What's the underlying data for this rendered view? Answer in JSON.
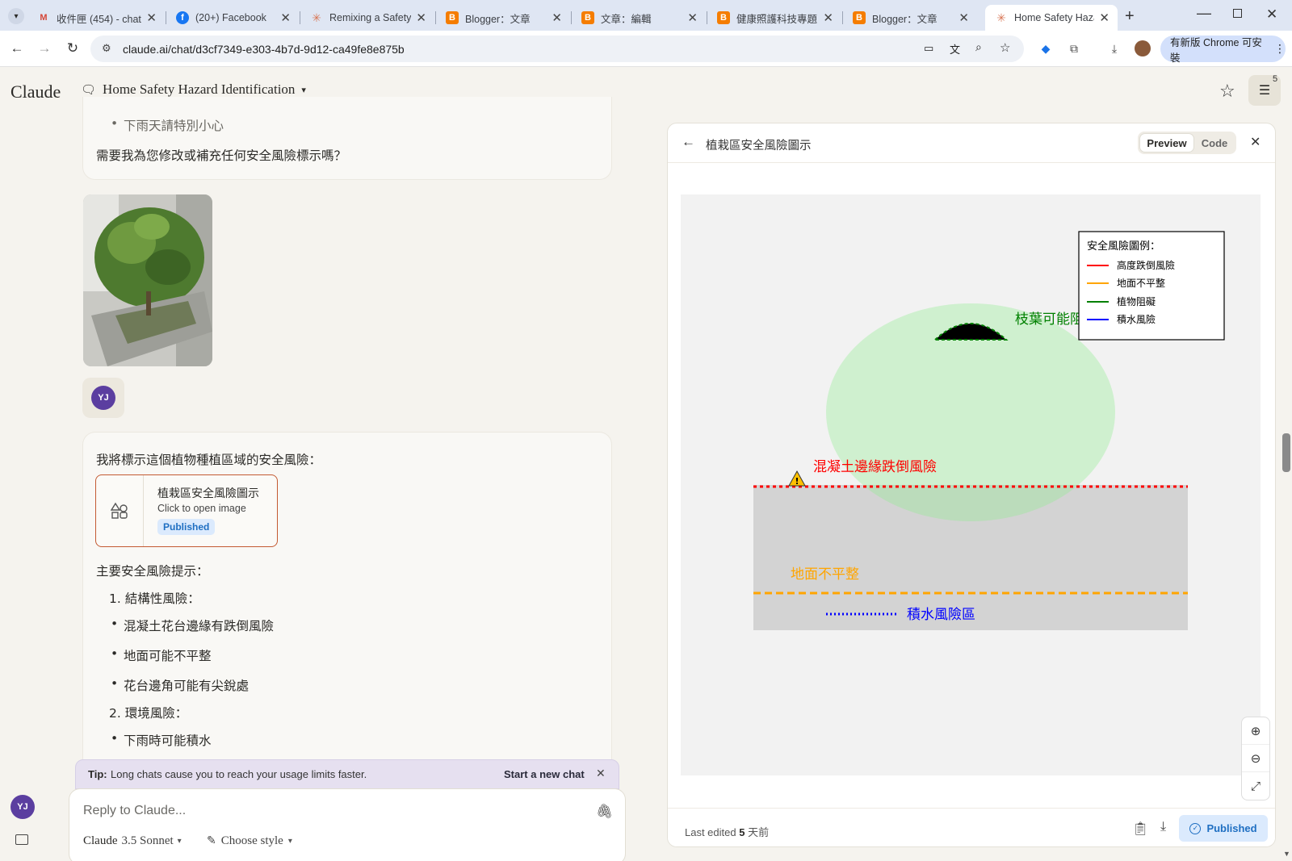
{
  "browser": {
    "tabs": [
      {
        "title": "收件匣 (454) - chat",
        "favicon": "gmail-icon",
        "color": "#d44638",
        "fav_text": "M"
      },
      {
        "title": "(20+) Facebook",
        "favicon": "facebook-icon",
        "color": "#1877f2",
        "fav_text": "f"
      },
      {
        "title": "Remixing a Safety",
        "favicon": "claude-icon",
        "color": "#d97757",
        "fav_text": "✳"
      },
      {
        "title": "Blogger：文章",
        "favicon": "blogger-icon",
        "color": "#f57d00",
        "fav_text": "B"
      },
      {
        "title": "文章：編輯",
        "favicon": "blogger-icon",
        "color": "#f57d00",
        "fav_text": "B"
      },
      {
        "title": "健康照護科技專題",
        "favicon": "blogger-icon",
        "color": "#f57d00",
        "fav_text": "B"
      },
      {
        "title": "Blogger：文章",
        "favicon": "blogger-icon",
        "color": "#f57d00",
        "fav_text": "B"
      },
      {
        "title": "Home Safety Haza",
        "favicon": "claude-icon",
        "color": "#d97757",
        "fav_text": "✳",
        "active": true
      }
    ],
    "url": "claude.ai/chat/d3cf7349-e303-4b7d-9d12-ca49fe8e875b",
    "update_label": "有新版 Chrome 可安裝"
  },
  "app": {
    "brand": "Claude",
    "chat_title": "Home Safety Hazard Identification",
    "filter_badge": "5"
  },
  "chat": {
    "prev_item": "下雨天請特別小心",
    "prev_question": "需要我為您修改或補充任何安全風險標示嗎？",
    "user_initials": "YJ",
    "intro": "我將標示這個植物種植區域的安全風險：",
    "artifact_card": {
      "title": "植栽區安全風險圖示",
      "subtitle": "Click to open image",
      "badge": "Published"
    },
    "heading": "主要安全風險提示：",
    "section1": "結構性風險：",
    "s1_items": [
      "混凝土花台邊緣有跌倒風險",
      "地面可能不平整",
      "花台邊角可能有尖銳處"
    ],
    "section2": "環境風險：",
    "s2_items": [
      "下雨時可能積水"
    ]
  },
  "tip": {
    "label": "Tip:",
    "text": "Long chats cause you to reach your usage limits faster.",
    "action": "Start a new chat"
  },
  "composer": {
    "placeholder": "Reply to Claude...",
    "model_name": "Claude",
    "model_version": "3.5 Sonnet",
    "style_label": "Choose style"
  },
  "artifact": {
    "title": "植栽區安全風險圖示",
    "tab_preview": "Preview",
    "tab_code": "Code",
    "footer_prefix": "Last edited",
    "footer_number": "5",
    "footer_suffix": "天前",
    "published_label": "Published",
    "diagram": {
      "legend_title": "安全風險圖例：",
      "legend": [
        {
          "label": "高度跌倒風險",
          "color": "#ff0000"
        },
        {
          "label": "地面不平整",
          "color": "#ffa500"
        },
        {
          "label": "植物阻礙",
          "color": "#008000"
        },
        {
          "label": "積水風險",
          "color": "#0000ff"
        }
      ],
      "label_plant": "枝葉可能阻",
      "label_fall": "混凝土邊緣跌倒風險",
      "label_uneven": "地面不平整",
      "label_water": "積水風險區",
      "warning_glyph": "!"
    }
  },
  "colors": {
    "accent": "#c35a32",
    "avatar": "#5b3ea0",
    "published_bg": "#dbeafd",
    "published_text": "#1f6fc2"
  }
}
